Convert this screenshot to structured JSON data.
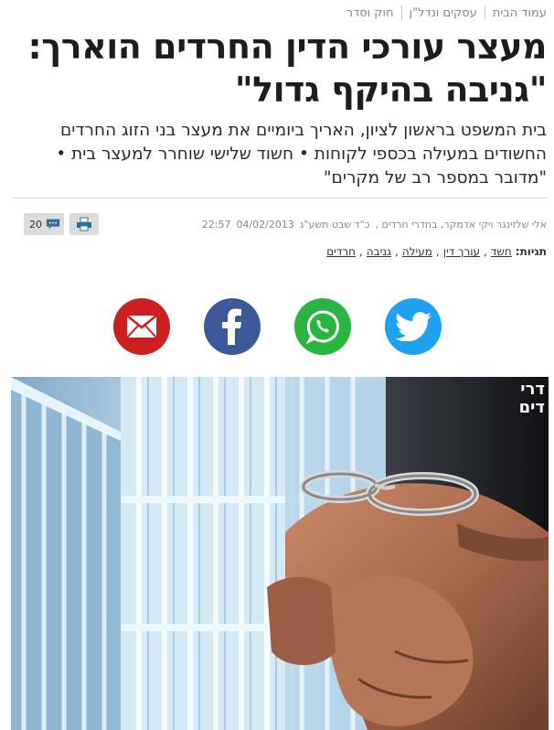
{
  "breadcrumb": [
    "עמוד הבית",
    "עסקים ונדל\"ן",
    "חוק וסדר"
  ],
  "headline": "מעצר עורכי הדין החרדים הוארך: \"גניבה בהיקף גדול\"",
  "subtitle": "בית המשפט בראשון לציון, האריך ביומיים את מעצר בני הזוג החרדים החשודים במעילה בכספי לקוחות • חשוד שלישי שוחרר למעצר בית • \"מדובר במספר רב של מקרים\"",
  "byline": {
    "authors": "אלי שלזינגר ויקי אדמקר, בחדרי חרדים ,",
    "hebrew_date": "כ\"ד שבט תשע\"ג",
    "date": "04/02/2013",
    "time": "22:57"
  },
  "tools": {
    "comments_count": "20",
    "comments_icon": "comment-bubble-icon",
    "print_icon": "printer-icon"
  },
  "tags": {
    "label": "תגיות:",
    "items": [
      "חשד",
      "עורך דין",
      "מעילה",
      "גניבה",
      "חרדים"
    ],
    "separator": ","
  },
  "share": {
    "buttons": [
      {
        "icon": "email-icon",
        "color": "#cc1f1f"
      },
      {
        "icon": "facebook-icon",
        "color": "#3b5998"
      },
      {
        "icon": "whatsapp-icon",
        "color": "#2ab540"
      },
      {
        "icon": "twitter-icon",
        "color": "#1da1f2"
      }
    ]
  },
  "hero": {
    "watermark_line1": "דרי",
    "watermark_line2": "דים"
  }
}
